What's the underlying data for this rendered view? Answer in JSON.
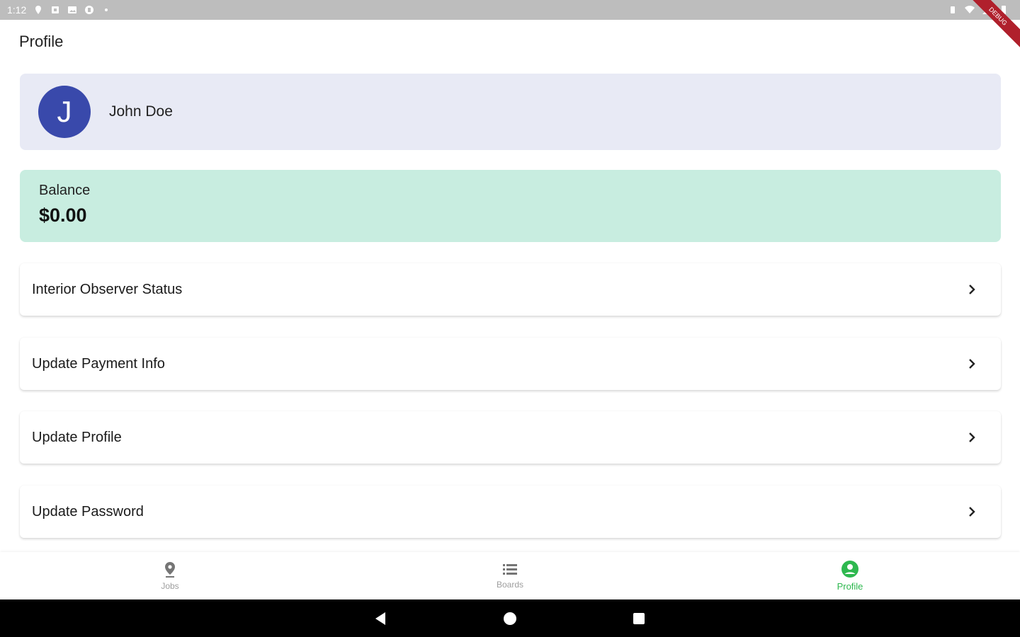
{
  "status_bar": {
    "time": "1:12",
    "left_icons": [
      "location-icon",
      "notification-icon",
      "image-icon",
      "app-icon",
      "dot-icon"
    ],
    "right_icons": [
      "vibrate-icon",
      "wifi-icon",
      "signal-icon",
      "battery-icon"
    ],
    "debug_banner": "DEBUG"
  },
  "app_bar": {
    "title": "Profile"
  },
  "user": {
    "initial": "J",
    "name": "John Doe",
    "avatar_color": "#3949ab",
    "card_color": "#e8eaf5"
  },
  "balance": {
    "label": "Balance",
    "value": "$0.00",
    "card_color": "#c8ede0"
  },
  "menu": [
    {
      "label": "Interior Observer Status",
      "icon": "chevron-right-icon"
    },
    {
      "label": "Update Payment Info",
      "icon": "chevron-right-icon"
    },
    {
      "label": "Update Profile",
      "icon": "chevron-right-icon"
    },
    {
      "label": "Update Password",
      "icon": "chevron-right-icon"
    }
  ],
  "bottom_nav": {
    "items": [
      {
        "label": "Jobs",
        "icon": "map-pin-icon",
        "active": false
      },
      {
        "label": "Boards",
        "icon": "list-icon",
        "active": false
      },
      {
        "label": "Profile",
        "icon": "account-circle-icon",
        "active": true
      }
    ],
    "active_color": "#2eb84f",
    "inactive_color": "#9e9e9e"
  },
  "system_nav": {
    "buttons": [
      "back-icon",
      "home-icon",
      "recents-icon"
    ]
  }
}
